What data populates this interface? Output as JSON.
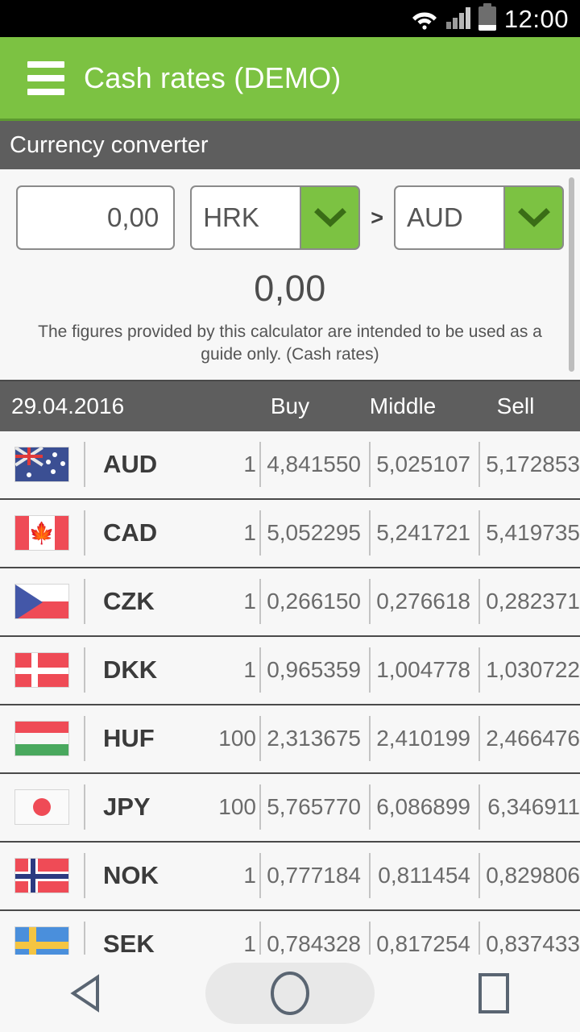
{
  "status_bar": {
    "time": "12:00",
    "icons": [
      "wifi-icon",
      "signal-icon",
      "battery-icon"
    ]
  },
  "app_bar": {
    "menu_icon": "hamburger-menu-icon",
    "title": "Cash rates (DEMO)"
  },
  "converter": {
    "section_title": "Currency converter",
    "amount_value": "0,00",
    "amount_placeholder": "0,00",
    "from_currency": "HRK",
    "to_currency": "AUD",
    "separator": ">",
    "dropdown_icon": "chevron-down-icon",
    "result": "0,00",
    "disclaimer": "The figures provided by this calculator are intended to be used as a guide only. (Cash rates)"
  },
  "rates_table": {
    "date": "29.04.2016",
    "columns": [
      "Buy",
      "Middle",
      "Sell"
    ],
    "rows": [
      {
        "flag": "flag-australia",
        "code": "AUD",
        "unit": "1",
        "buy": "4,841550",
        "middle": "5,025107",
        "sell": "5,172853"
      },
      {
        "flag": "flag-canada",
        "code": "CAD",
        "unit": "1",
        "buy": "5,052295",
        "middle": "5,241721",
        "sell": "5,419735"
      },
      {
        "flag": "flag-czechia",
        "code": "CZK",
        "unit": "1",
        "buy": "0,266150",
        "middle": "0,276618",
        "sell": "0,282371"
      },
      {
        "flag": "flag-denmark",
        "code": "DKK",
        "unit": "1",
        "buy": "0,965359",
        "middle": "1,004778",
        "sell": "1,030722"
      },
      {
        "flag": "flag-hungary",
        "code": "HUF",
        "unit": "100",
        "buy": "2,313675",
        "middle": "2,410199",
        "sell": "2,466476"
      },
      {
        "flag": "flag-japan",
        "code": "JPY",
        "unit": "100",
        "buy": "5,765770",
        "middle": "6,086899",
        "sell": "6,346911"
      },
      {
        "flag": "flag-norway",
        "code": "NOK",
        "unit": "1",
        "buy": "0,777184",
        "middle": "0,811454",
        "sell": "0,829806"
      },
      {
        "flag": "flag-sweden",
        "code": "SEK",
        "unit": "1",
        "buy": "0,784328",
        "middle": "0,817254",
        "sell": "0,837433"
      }
    ]
  },
  "nav_bar": {
    "back": "back-triangle-icon",
    "home": "home-circle-icon",
    "recents": "recents-square-icon"
  },
  "colors": {
    "accent_green": "#7cc242",
    "header_grey": "#5e5e5e",
    "status_black": "#000000",
    "page_bg": "#f7f7f7"
  }
}
